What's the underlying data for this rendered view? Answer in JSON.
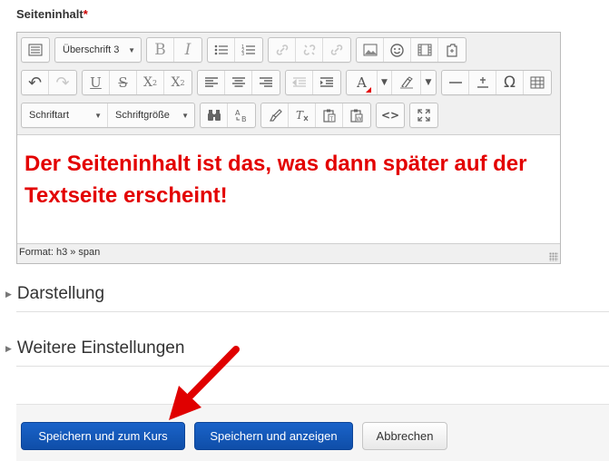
{
  "field": {
    "label": "Seiteninhalt",
    "required_mark": "*"
  },
  "toolbar": {
    "row1": {
      "toggle_icon": "kitchen-sink-icon",
      "heading_select": "Überschrift 3",
      "bold": "B",
      "italic": "I",
      "unordered_list_icon": "bullet-list-icon",
      "ordered_list_icon": "numbered-list-icon",
      "link_icon": "link-icon",
      "unlink_icon": "unlink-icon",
      "anchor_icon": "anchor-icon",
      "image_icon": "image-icon",
      "emoticon_icon": "emoticon-icon",
      "media_icon": "media-icon",
      "file_icon": "file-manager-icon"
    },
    "row2": {
      "undo": "↶",
      "redo": "↷",
      "underline": "U",
      "strike": "S",
      "subscript": "X",
      "sub_mark": "2",
      "superscript": "X",
      "sup_mark": "2",
      "text_color": "A",
      "omega": "Ω"
    },
    "row3": {
      "font_select": "Schriftart",
      "size_select": "Schriftgröße",
      "code": "<>"
    }
  },
  "content": {
    "heading_text": "Der Seiteninhalt ist das, was dann später auf der Textseite erscheint!",
    "heading_color": "#e30000"
  },
  "statusbar": {
    "path": "Format: h3 » span"
  },
  "sections": [
    {
      "label": "Darstellung"
    },
    {
      "label": "Weitere Einstellungen"
    }
  ],
  "buttons": {
    "save_return": "Speichern und zum Kurs",
    "save_display": "Speichern und anzeigen",
    "cancel": "Abbrechen"
  },
  "colors": {
    "primary": "#1a63c9",
    "annotation_arrow": "#e00000"
  }
}
